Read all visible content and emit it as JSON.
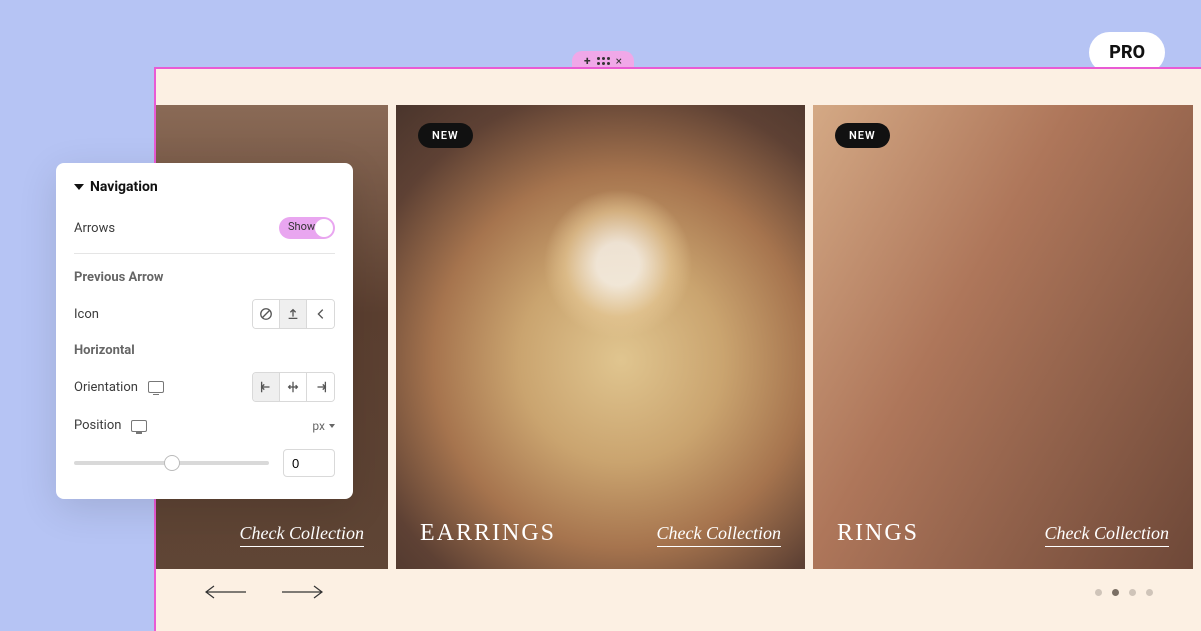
{
  "pro_badge": "PRO",
  "carousel": {
    "slides": [
      {
        "link": "Check Collection"
      },
      {
        "badge": "NEW",
        "title": "EARRINGS",
        "link": "Check Collection"
      },
      {
        "badge": "NEW",
        "title": "RINGS",
        "link": "Check Collection"
      }
    ],
    "active_dot": 1,
    "dot_count": 4
  },
  "panel": {
    "section_title": "Navigation",
    "arrows_label": "Arrows",
    "arrows_toggle": "Show",
    "previous_arrow_label": "Previous Arrow",
    "icon_label": "Icon",
    "horizontal_label": "Horizontal",
    "orientation_label": "Orientation",
    "position_label": "Position",
    "position_unit": "px",
    "position_value": "0"
  }
}
